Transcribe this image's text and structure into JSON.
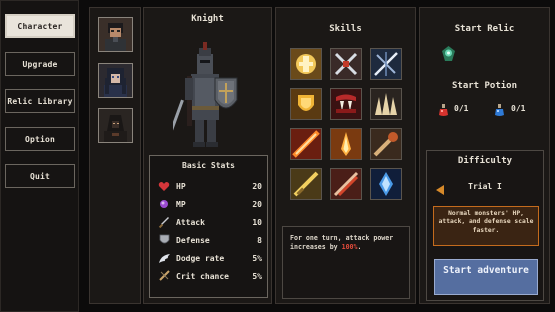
{
  "menu": {
    "items": [
      {
        "label": "Character",
        "active": true
      },
      {
        "label": "Upgrade",
        "active": false
      },
      {
        "label": "Relic Library",
        "active": false
      },
      {
        "label": "Option",
        "active": false
      },
      {
        "label": "Quit",
        "active": false
      }
    ]
  },
  "character": {
    "name": "Knight",
    "stats_title": "Basic Stats",
    "stats": [
      {
        "icon": "heart-icon",
        "label": "HP",
        "value": "20"
      },
      {
        "icon": "mana-orb-icon",
        "label": "MP",
        "value": "20"
      },
      {
        "icon": "sword-icon",
        "label": "Attack",
        "value": "10"
      },
      {
        "icon": "shield-icon",
        "label": "Defense",
        "value": "8"
      },
      {
        "icon": "wing-icon",
        "label": "Dodge rate",
        "value": "5%"
      },
      {
        "icon": "crit-icon",
        "label": "Crit chance",
        "value": "5%"
      }
    ]
  },
  "skills": {
    "title": "Skills",
    "description_pre": "For one turn, attack power increases by ",
    "description_highlight": "100%",
    "description_post": "."
  },
  "relic": {
    "title": "Start Relic"
  },
  "potion": {
    "title": "Start Potion",
    "red_count": "0/1",
    "blue_count": "0/1"
  },
  "difficulty": {
    "title": "Difficulty",
    "level": "Trial I",
    "description": "Normal monsters' HP, attack, and defense scale faster."
  },
  "start_button": "Start adventure",
  "colors": {
    "accent_orange": "#c46b1d",
    "start_blue": "#556ea0",
    "highlight_red": "#e34b3b"
  }
}
